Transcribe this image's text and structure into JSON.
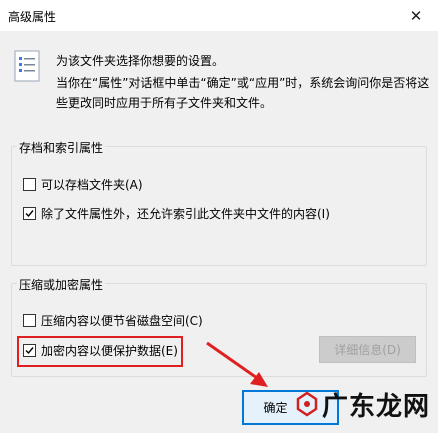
{
  "window": {
    "title": "高级属性",
    "close_glyph": "✕"
  },
  "intro": {
    "line1": "为该文件夹选择你想要的设置。",
    "line2": "当你在“属性”对话框中单击“确定”或“应用”时，系统会询问你是否将这些更改同时应用于所有子文件夹和文件。"
  },
  "archive_group": {
    "title": "存档和索引属性",
    "options": [
      {
        "label": "可以存档文件夹(A)",
        "checked": false
      },
      {
        "label": "除了文件属性外，还允许索引此文件夹中文件的内容(I)",
        "checked": true
      }
    ]
  },
  "compress_group": {
    "title": "压缩或加密属性",
    "options": [
      {
        "label": "压缩内容以便节省磁盘空间(C)",
        "checked": false
      },
      {
        "label": "加密内容以便保护数据(E)",
        "checked": true
      }
    ],
    "details_button": "详细信息(D)"
  },
  "buttons": {
    "ok": "确定"
  },
  "watermark": {
    "text": "广东龙网"
  },
  "colors": {
    "highlight": "#e02020",
    "accent": "#0078d7"
  }
}
